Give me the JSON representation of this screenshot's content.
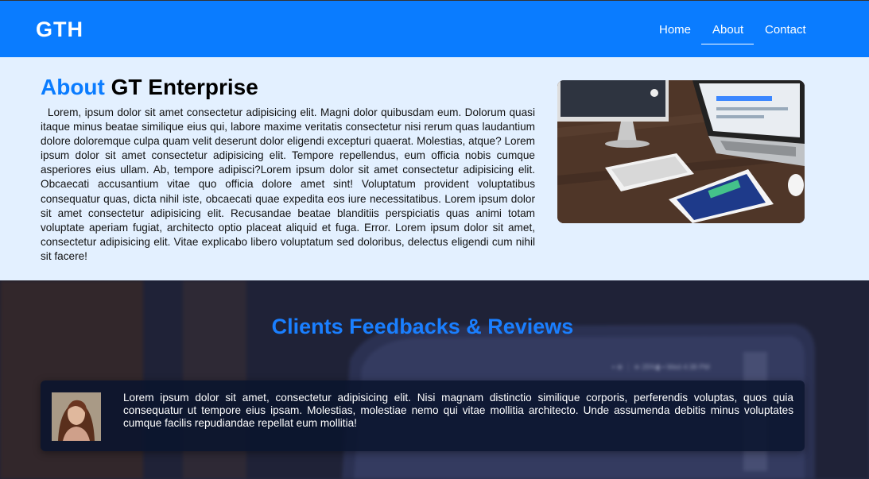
{
  "navbar": {
    "brand": "GTH",
    "links": [
      {
        "label": "Home"
      },
      {
        "label": "About"
      },
      {
        "label": "Contact"
      }
    ],
    "accent_color": "#0a7cff"
  },
  "about": {
    "title_accent": "About",
    "title_rest": "GT Enterprise",
    "body": "Lorem, ipsum dolor sit amet consectetur adipisicing elit. Magni dolor quibusdam eum. Dolorum quasi itaque minus beatae similique eius qui, labore maxime veritatis consectetur nisi rerum quas laudantium dolore doloremque culpa quam velit deserunt dolor eligendi excepturi quaerat. Molestias, atque? Lorem ipsum dolor sit amet consectetur adipisicing elit. Tempore repellendus, eum officia nobis cumque asperiores eius ullam. Ab, tempore adipisci?Lorem ipsum dolor sit amet consectetur adipisicing elit. Obcaecati accusantium vitae quo officia dolore amet sint! Voluptatum provident voluptatibus consequatur quas, dicta nihil iste, obcaecati quae expedita eos iure necessitatibus. Lorem ipsum dolor sit amet consectetur adipisicing elit. Recusandae beatae blanditiis perspiciatis quas animi totam voluptate aperiam fugiat, architecto optio placeat aliquid et fuga. Error. Lorem ipsum dolor sit amet, consectetur adipisicing elit. Vitae explicabo libero voluptatum sed doloribus, delectus eligendi cum nihil sit facere!"
  },
  "reviews": {
    "title": "Clients Feedbacks & Reviews",
    "items": [
      {
        "text": "Lorem ipsum dolor sit amet, consectetur adipisicing elit. Nisi magnam distinctio similique corporis, perferendis voluptas, quos quia consequatur ut tempore eius ipsam. Molestias, molestiae nemo qui vitae mollitia architecto. Unde assumenda debitis minus voluptates cumque facilis repudiandae repellat eum mollitia!"
      }
    ]
  }
}
